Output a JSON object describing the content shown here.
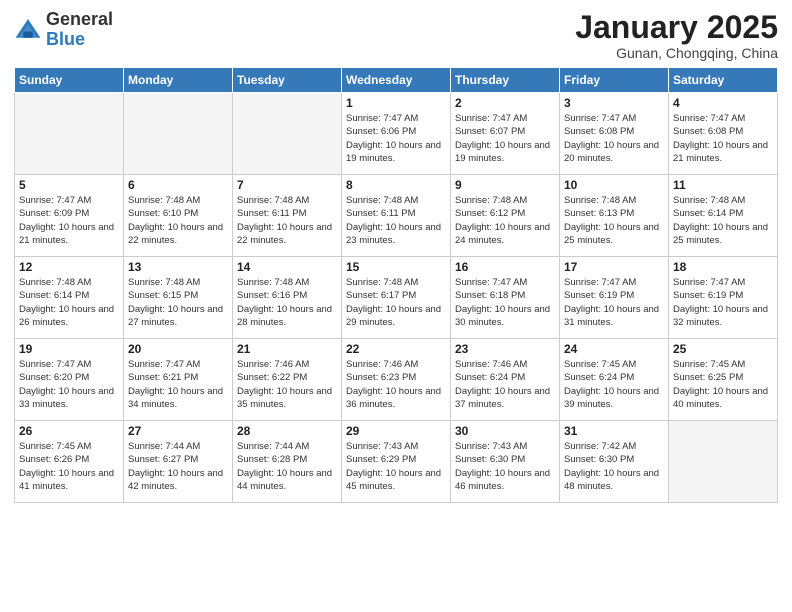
{
  "logo": {
    "general": "General",
    "blue": "Blue"
  },
  "header": {
    "title": "January 2025",
    "subtitle": "Gunan, Chongqing, China"
  },
  "weekdays": [
    "Sunday",
    "Monday",
    "Tuesday",
    "Wednesday",
    "Thursday",
    "Friday",
    "Saturday"
  ],
  "weeks": [
    [
      {
        "day": "",
        "info": ""
      },
      {
        "day": "",
        "info": ""
      },
      {
        "day": "",
        "info": ""
      },
      {
        "day": "1",
        "info": "Sunrise: 7:47 AM\nSunset: 6:06 PM\nDaylight: 10 hours and 19 minutes."
      },
      {
        "day": "2",
        "info": "Sunrise: 7:47 AM\nSunset: 6:07 PM\nDaylight: 10 hours and 19 minutes."
      },
      {
        "day": "3",
        "info": "Sunrise: 7:47 AM\nSunset: 6:08 PM\nDaylight: 10 hours and 20 minutes."
      },
      {
        "day": "4",
        "info": "Sunrise: 7:47 AM\nSunset: 6:08 PM\nDaylight: 10 hours and 21 minutes."
      }
    ],
    [
      {
        "day": "5",
        "info": "Sunrise: 7:47 AM\nSunset: 6:09 PM\nDaylight: 10 hours and 21 minutes."
      },
      {
        "day": "6",
        "info": "Sunrise: 7:48 AM\nSunset: 6:10 PM\nDaylight: 10 hours and 22 minutes."
      },
      {
        "day": "7",
        "info": "Sunrise: 7:48 AM\nSunset: 6:11 PM\nDaylight: 10 hours and 22 minutes."
      },
      {
        "day": "8",
        "info": "Sunrise: 7:48 AM\nSunset: 6:11 PM\nDaylight: 10 hours and 23 minutes."
      },
      {
        "day": "9",
        "info": "Sunrise: 7:48 AM\nSunset: 6:12 PM\nDaylight: 10 hours and 24 minutes."
      },
      {
        "day": "10",
        "info": "Sunrise: 7:48 AM\nSunset: 6:13 PM\nDaylight: 10 hours and 25 minutes."
      },
      {
        "day": "11",
        "info": "Sunrise: 7:48 AM\nSunset: 6:14 PM\nDaylight: 10 hours and 25 minutes."
      }
    ],
    [
      {
        "day": "12",
        "info": "Sunrise: 7:48 AM\nSunset: 6:14 PM\nDaylight: 10 hours and 26 minutes."
      },
      {
        "day": "13",
        "info": "Sunrise: 7:48 AM\nSunset: 6:15 PM\nDaylight: 10 hours and 27 minutes."
      },
      {
        "day": "14",
        "info": "Sunrise: 7:48 AM\nSunset: 6:16 PM\nDaylight: 10 hours and 28 minutes."
      },
      {
        "day": "15",
        "info": "Sunrise: 7:48 AM\nSunset: 6:17 PM\nDaylight: 10 hours and 29 minutes."
      },
      {
        "day": "16",
        "info": "Sunrise: 7:47 AM\nSunset: 6:18 PM\nDaylight: 10 hours and 30 minutes."
      },
      {
        "day": "17",
        "info": "Sunrise: 7:47 AM\nSunset: 6:19 PM\nDaylight: 10 hours and 31 minutes."
      },
      {
        "day": "18",
        "info": "Sunrise: 7:47 AM\nSunset: 6:19 PM\nDaylight: 10 hours and 32 minutes."
      }
    ],
    [
      {
        "day": "19",
        "info": "Sunrise: 7:47 AM\nSunset: 6:20 PM\nDaylight: 10 hours and 33 minutes."
      },
      {
        "day": "20",
        "info": "Sunrise: 7:47 AM\nSunset: 6:21 PM\nDaylight: 10 hours and 34 minutes."
      },
      {
        "day": "21",
        "info": "Sunrise: 7:46 AM\nSunset: 6:22 PM\nDaylight: 10 hours and 35 minutes."
      },
      {
        "day": "22",
        "info": "Sunrise: 7:46 AM\nSunset: 6:23 PM\nDaylight: 10 hours and 36 minutes."
      },
      {
        "day": "23",
        "info": "Sunrise: 7:46 AM\nSunset: 6:24 PM\nDaylight: 10 hours and 37 minutes."
      },
      {
        "day": "24",
        "info": "Sunrise: 7:45 AM\nSunset: 6:24 PM\nDaylight: 10 hours and 39 minutes."
      },
      {
        "day": "25",
        "info": "Sunrise: 7:45 AM\nSunset: 6:25 PM\nDaylight: 10 hours and 40 minutes."
      }
    ],
    [
      {
        "day": "26",
        "info": "Sunrise: 7:45 AM\nSunset: 6:26 PM\nDaylight: 10 hours and 41 minutes."
      },
      {
        "day": "27",
        "info": "Sunrise: 7:44 AM\nSunset: 6:27 PM\nDaylight: 10 hours and 42 minutes."
      },
      {
        "day": "28",
        "info": "Sunrise: 7:44 AM\nSunset: 6:28 PM\nDaylight: 10 hours and 44 minutes."
      },
      {
        "day": "29",
        "info": "Sunrise: 7:43 AM\nSunset: 6:29 PM\nDaylight: 10 hours and 45 minutes."
      },
      {
        "day": "30",
        "info": "Sunrise: 7:43 AM\nSunset: 6:30 PM\nDaylight: 10 hours and 46 minutes."
      },
      {
        "day": "31",
        "info": "Sunrise: 7:42 AM\nSunset: 6:30 PM\nDaylight: 10 hours and 48 minutes."
      },
      {
        "day": "",
        "info": ""
      }
    ]
  ]
}
